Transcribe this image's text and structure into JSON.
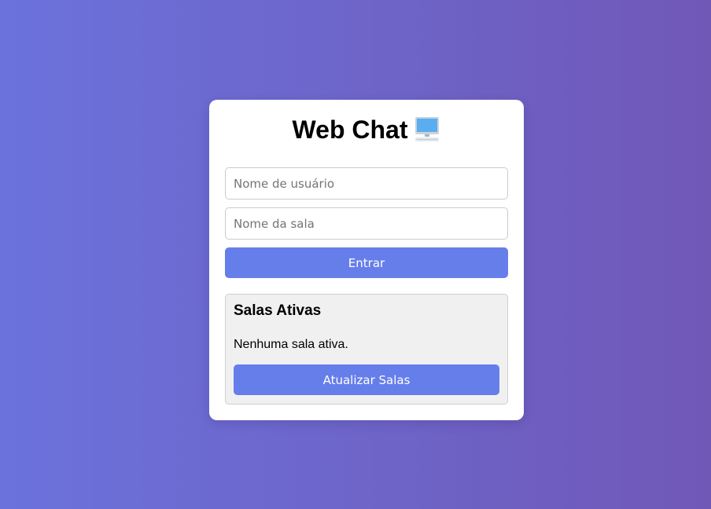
{
  "app": {
    "title": "Web Chat",
    "title_icon": "computer-icon"
  },
  "login": {
    "username_placeholder": "Nome de usuário",
    "username_value": "",
    "room_placeholder": "Nome da sala",
    "room_value": "",
    "enter_label": "Entrar"
  },
  "rooms": {
    "title": "Salas Ativas",
    "empty_text": "Nenhuma sala ativa.",
    "refresh_label": "Atualizar Salas"
  },
  "colors": {
    "gradient_start": "#6b72dc",
    "gradient_end": "#7058b7",
    "accent": "#667eea",
    "panel_bg": "#f0f0f0",
    "card_bg": "#ffffff"
  }
}
